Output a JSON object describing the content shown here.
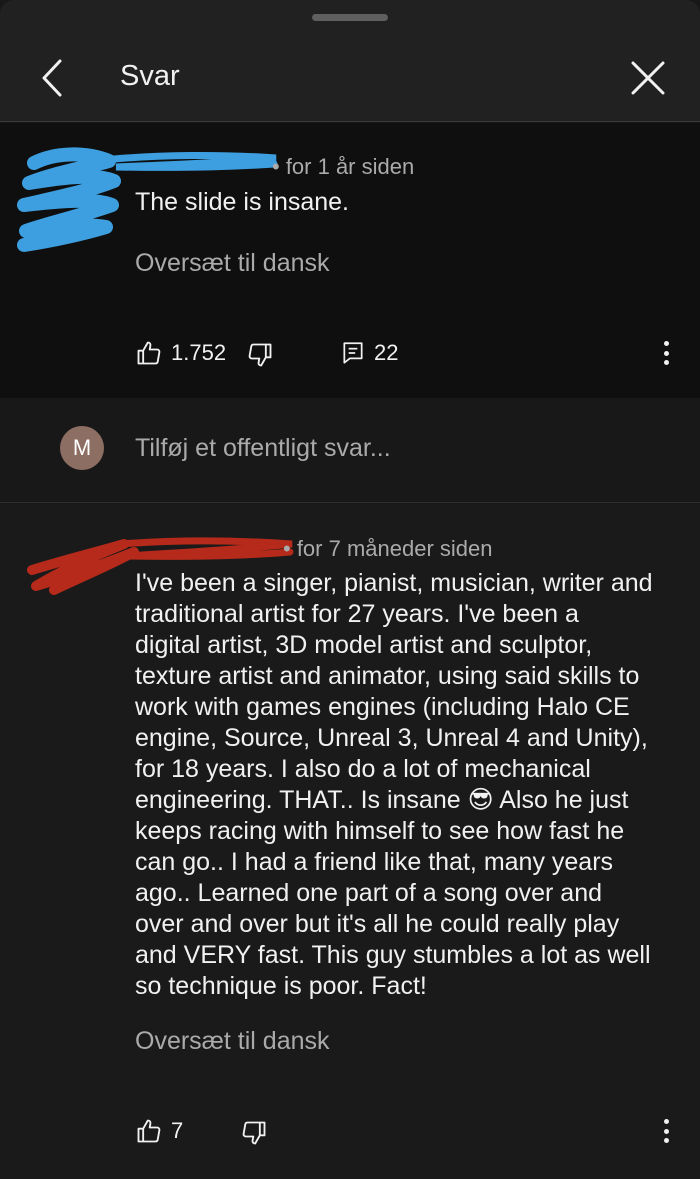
{
  "header": {
    "title": "Svar"
  },
  "main_comment": {
    "timestamp": "• for 1 år siden",
    "text": "The slide is insane.",
    "translate_label": "Oversæt til dansk",
    "like_count": "1.752",
    "reply_count": "22"
  },
  "reply_box": {
    "avatar_initial": "M",
    "placeholder": "Tilføj et offentligt svar..."
  },
  "reply_comment": {
    "timestamp": "• for 7 måneder siden",
    "lines": [
      "I've been a singer, pianist, musician, writer and",
      "traditional artist for 27 years. I've been a",
      "digital artist, 3D model artist and sculptor,",
      "texture artist and animator, using said skills to",
      "work with games engines (including Halo CE",
      "engine, Source, Unreal 3, Unreal 4 and Unity),",
      "for 18 years. I also do a lot of mechanical",
      "engineering. THAT.. Is insane 😎 Also he just",
      "keeps racing with himself to see how fast he",
      "can go.. I had a friend like that, many years",
      "ago.. Learned one part of a song over and",
      "over and over but it's all he could really play",
      "and VERY fast. This guy stumbles a lot as well",
      "so technique is poor. Fact!"
    ],
    "translate_label": "Oversæt til dansk",
    "like_count": "7"
  },
  "colors": {
    "background": "#181818",
    "comment_bg": "#0f0f0f",
    "secondary_text": "#aaaaaa",
    "scribble_blue": "#3d9fe0",
    "scribble_red": "#b52a1a",
    "avatar_bg": "#8d6e63"
  },
  "icons": [
    "back-arrow-icon",
    "close-icon",
    "thumbs-up-icon",
    "thumbs-down-icon",
    "reply-icon",
    "more-vert-icon"
  ]
}
